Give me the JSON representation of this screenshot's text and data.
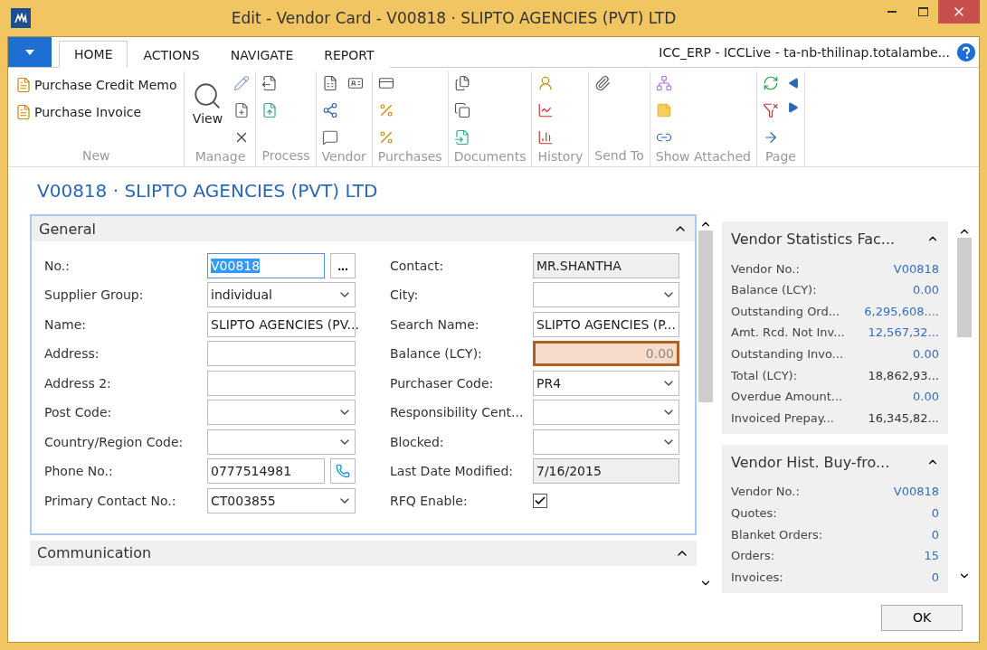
{
  "window": {
    "title": "Edit - Vendor Card - V00818 · SLIPTO AGENCIES (PVT) LTD"
  },
  "tabs": [
    {
      "label": "HOME",
      "selected": true
    },
    {
      "label": "ACTIONS",
      "selected": false
    },
    {
      "label": "NAVIGATE",
      "selected": false
    },
    {
      "label": "REPORT",
      "selected": false
    }
  ],
  "connection": "ICC_ERP - ICCLive - ta-nb-thilinap.totalambe...",
  "ribbon_groups": [
    {
      "label": "New",
      "buttons": [
        "Purchase Credit Memo",
        "Purchase Invoice"
      ]
    },
    {
      "label": "Manage",
      "buttons": [
        "View"
      ]
    },
    {
      "label": "Process"
    },
    {
      "label": "Vendor"
    },
    {
      "label": "Purchases"
    },
    {
      "label": "Documents"
    },
    {
      "label": "History"
    },
    {
      "label": "Send To"
    },
    {
      "label": "Show Attached"
    },
    {
      "label": "Page"
    }
  ],
  "page_title": "V00818 · SLIPTO AGENCIES (PVT) LTD",
  "general": {
    "title": "General",
    "expanded": true,
    "left_fields": [
      {
        "label": "No.:",
        "kind": "lookup",
        "value": "V00818",
        "button": "...",
        "focused": true
      },
      {
        "label": "Supplier Group:",
        "kind": "select",
        "value": "individual",
        "focused": false
      },
      {
        "label": "Name:",
        "kind": "text",
        "value": "SLIPTO AGENCIES (PV...",
        "focused": false
      },
      {
        "label": "Address:",
        "kind": "text",
        "focused": false
      },
      {
        "label": "Address 2:",
        "kind": "text",
        "focused": false
      },
      {
        "label": "Post Code:",
        "kind": "select",
        "focused": false
      },
      {
        "label": "Country/Region Code:",
        "kind": "select",
        "focused": false
      },
      {
        "label": "Phone No.:",
        "kind": "phone",
        "value": "0777514981",
        "focused": false
      },
      {
        "label": "Primary Contact No.:",
        "kind": "select",
        "value": "CT003855",
        "focused": false
      }
    ],
    "right_fields": [
      {
        "label": "Contact:",
        "kind": "readonly",
        "value": "MR.SHANTHA",
        "focused": false
      },
      {
        "label": "City:",
        "kind": "select",
        "focused": false
      },
      {
        "label": "Search Name:",
        "kind": "text",
        "value": "SLIPTO AGENCIES (P...",
        "focused": false
      },
      {
        "label": "Balance (LCY):",
        "kind": "amount",
        "value": "0.00",
        "focused": true
      },
      {
        "label": "Purchaser Code:",
        "kind": "select",
        "value": "PR4",
        "focused": false
      },
      {
        "label": "Responsibility Cent...",
        "kind": "select",
        "focused": false
      },
      {
        "label": "Blocked:",
        "kind": "select",
        "focused": false
      },
      {
        "label": "Last Date Modified:",
        "kind": "readonly",
        "value": "7/16/2015",
        "focused": false
      },
      {
        "label": "RFQ Enable:",
        "kind": "checkbox",
        "checked": true,
        "focused": false
      }
    ]
  },
  "communication": {
    "title": "Communication",
    "expanded": true
  },
  "factboxes": [
    {
      "title": "Vendor Statistics Fac...",
      "rows": [
        {
          "label": "Vendor No.:",
          "value": "V00818",
          "link": true
        },
        {
          "label": "Balance (LCY):",
          "value": "0.00",
          "link": true
        },
        {
          "label": "Outstanding Ord...",
          "value": "6,295,608....",
          "link": true
        },
        {
          "label": "Amt. Rcd. Not Inv...",
          "value": "12,567,32...",
          "link": true
        },
        {
          "label": "Outstanding Invo...",
          "value": "0.00",
          "link": true
        },
        {
          "label": "Total (LCY):",
          "value": "18,862,93...",
          "link": false
        },
        {
          "label": "Overdue Amount...",
          "value": "0.00",
          "link": true
        },
        {
          "label": "Invoiced Prepay...",
          "value": "16,345,82...",
          "link": false
        }
      ]
    },
    {
      "title": "Vendor Hist. Buy-fro...",
      "rows": [
        {
          "label": "Vendor No.:",
          "value": "V00818",
          "link": true
        },
        {
          "label": "Quotes:",
          "value": "0",
          "link": true
        },
        {
          "label": "Blanket Orders:",
          "value": "0",
          "link": true
        },
        {
          "label": "Orders:",
          "value": "15",
          "link": true
        },
        {
          "label": "Invoices:",
          "value": "0",
          "link": true
        }
      ]
    }
  ],
  "ok_button": "OK"
}
